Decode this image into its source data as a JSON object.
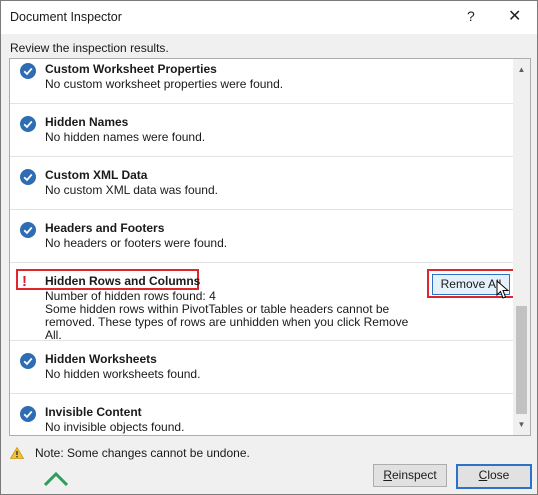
{
  "window": {
    "title": "Document Inspector",
    "help": "?",
    "close": "✕"
  },
  "subtitle": "Review the inspection results.",
  "items": [
    {
      "title": "Custom Worksheet Properties",
      "desc": "No custom worksheet properties were found.",
      "status": "ok"
    },
    {
      "title": "Hidden Names",
      "desc": "No hidden names were found.",
      "status": "ok"
    },
    {
      "title": "Custom XML Data",
      "desc": "No custom XML data was found.",
      "status": "ok"
    },
    {
      "title": "Headers and Footers",
      "desc": "No headers or footers were found.",
      "status": "ok"
    },
    {
      "title": "Hidden Rows and Columns",
      "desc1": "Number of hidden rows found: 4",
      "desc2": "Some hidden rows within PivotTables or table headers cannot be",
      "desc3": "removed. These types of rows are unhidden when you click Remove All.",
      "status": "warning",
      "warning_glyph": "!",
      "action": "Remove All"
    },
    {
      "title": "Hidden Worksheets",
      "desc": "No hidden worksheets found.",
      "status": "ok"
    },
    {
      "title": "Invisible Content",
      "desc": "No invisible objects found.",
      "status": "ok"
    }
  ],
  "note": "Note: Some changes cannot be undone.",
  "buttons": {
    "reinspect_first": "R",
    "reinspect_rest": "einspect",
    "close_first": "C",
    "close_rest": "lose"
  },
  "colors": {
    "ok": "#2e6db4",
    "warning": "#d2232a",
    "highlight": "#e0262d",
    "accent": "#2c73c7"
  },
  "icons": {
    "ok": "check-circle-icon",
    "warning": "exclamation-icon",
    "note": "warning-triangle-icon"
  }
}
